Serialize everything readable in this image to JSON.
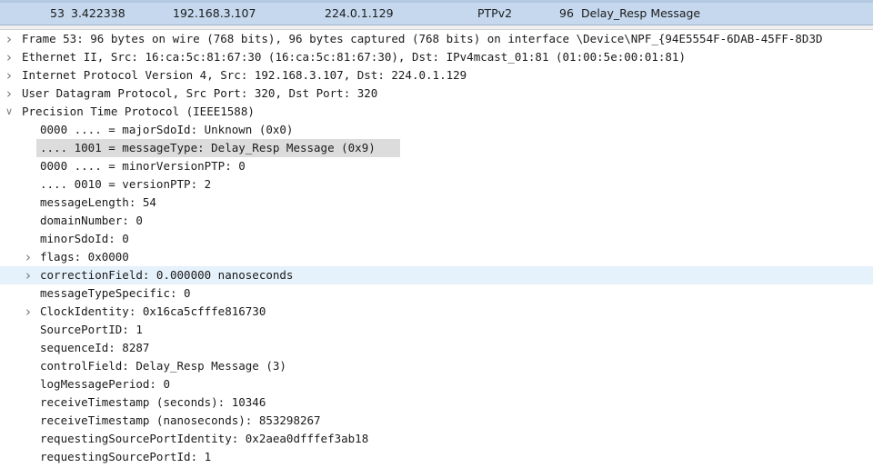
{
  "packet": {
    "no": "53",
    "time": "3.422338",
    "source": "192.168.3.107",
    "destination": "224.0.1.129",
    "protocol": "PTPv2",
    "length": "96",
    "info": "Delay_Resp Message"
  },
  "tree": [
    {
      "arrow": "chevron-right",
      "text": "Frame 53: 96 bytes on wire (768 bits), 96 bytes captured (768 bits) on interface \\Device\\NPF_{94E5554F-6DAB-45FF-8D3D"
    },
    {
      "arrow": "chevron-right",
      "text": "Ethernet II, Src: 16:ca:5c:81:67:30 (16:ca:5c:81:67:30), Dst: IPv4mcast_01:81 (01:00:5e:00:01:81)"
    },
    {
      "arrow": "chevron-right",
      "text": "Internet Protocol Version 4, Src: 192.168.3.107, Dst: 224.0.1.129"
    },
    {
      "arrow": "chevron-right",
      "text": "User Datagram Protocol, Src Port: 320, Dst Port: 320"
    },
    {
      "arrow": "chevron-down",
      "text": "Precision Time Protocol (IEEE1588)"
    },
    {
      "text": "0000 .... = majorSdoId: Unknown (0x0)"
    },
    {
      "text": ".... 1001 = messageType: Delay_Resp Message (0x9)",
      "state": "selected"
    },
    {
      "text": "0000 .... = minorVersionPTP: 0"
    },
    {
      "text": ".... 0010 = versionPTP: 2"
    },
    {
      "text": "messageLength: 54"
    },
    {
      "text": "domainNumber: 0"
    },
    {
      "text": "minorSdoId: 0"
    },
    {
      "arrow": "chevron-right",
      "text": "flags: 0x0000"
    },
    {
      "arrow": "chevron-right",
      "text": "correctionField: 0.000000 nanoseconds",
      "state": "hover"
    },
    {
      "text": "messageTypeSpecific: 0"
    },
    {
      "arrow": "chevron-right",
      "text": "ClockIdentity: 0x16ca5cfffe816730"
    },
    {
      "text": "SourcePortID: 1"
    },
    {
      "text": "sequenceId: 8287"
    },
    {
      "text": "controlField: Delay_Resp Message (3)"
    },
    {
      "text": "logMessagePeriod: 0"
    },
    {
      "text": "receiveTimestamp (seconds): 10346"
    },
    {
      "text": "receiveTimestamp (nanoseconds): 853298267"
    },
    {
      "text": "requestingSourcePortIdentity: 0x2aea0dfffef3ab18"
    },
    {
      "text": "requestingSourcePortId: 1"
    }
  ],
  "colors": {
    "selected_row": "#dcdcdc",
    "hover_row": "#e5f1fb",
    "packet_row": "#c5d8ee"
  }
}
